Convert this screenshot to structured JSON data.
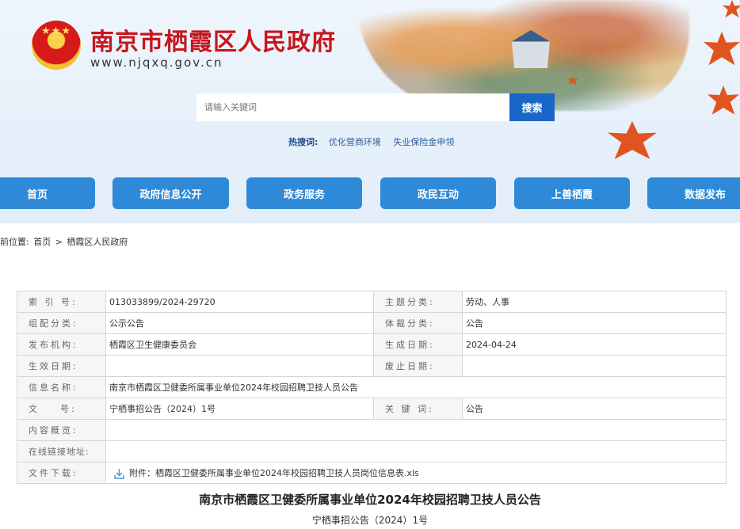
{
  "header": {
    "site_name": "南京市栖霞区人民政府",
    "site_url": "www.njqxq.gov.cn",
    "emblem_icon": "national-emblem-icon",
    "brand_color": "#c8161d"
  },
  "search": {
    "placeholder": "请输入关键词",
    "button_label": "搜索",
    "hot_label": "热搜词:",
    "hot_keywords": [
      "优化营商环境",
      "失业保险金申领"
    ]
  },
  "nav": {
    "accent_color": "#2e8ad9",
    "items": [
      "首页",
      "政府信息公开",
      "政务服务",
      "政民互动",
      "上善栖霞",
      "数据发布"
    ]
  },
  "breadcrumb": {
    "prefix": "前位置:",
    "home": "首页",
    "separator": ">",
    "current": "栖霞区人民政府"
  },
  "info_table": {
    "index_label": "索 引 号:",
    "index_value": "013033899/2024-29720",
    "topic_label": "主题分类:",
    "topic_value": "劳动、人事",
    "group_label": "组配分类:",
    "group_value": "公示公告",
    "genre_label": "体裁分类:",
    "genre_value": "公告",
    "publisher_label": "发布机构:",
    "publisher_value": "栖霞区卫生健康委员会",
    "created_label": "生成日期:",
    "created_value": "2024-04-24",
    "effective_label": "生效日期:",
    "effective_value": "",
    "abolished_label": "废止日期:",
    "abolished_value": "",
    "name_label": "信息名称:",
    "name_value": "南京市栖霞区卫健委所属事业单位2024年校园招聘卫技人员公告",
    "docno_label": "文    号:",
    "docno_value": "宁栖事招公告（2024）1号",
    "keyword_label": "关 键 词:",
    "keyword_value": "公告",
    "summary_label": "内容概览:",
    "summary_value": "",
    "link_label": "在线链接地址:",
    "link_value": "",
    "download_label": "文件下载:",
    "download_value": "附件：栖霞区卫健委所属事业单位2024年校园招聘卫技人员岗位信息表.xls"
  },
  "article": {
    "title": "南京市栖霞区卫健委所属事业单位2024年校园招聘卫技人员公告",
    "doc_number": "宁栖事招公告（2024）1号"
  }
}
